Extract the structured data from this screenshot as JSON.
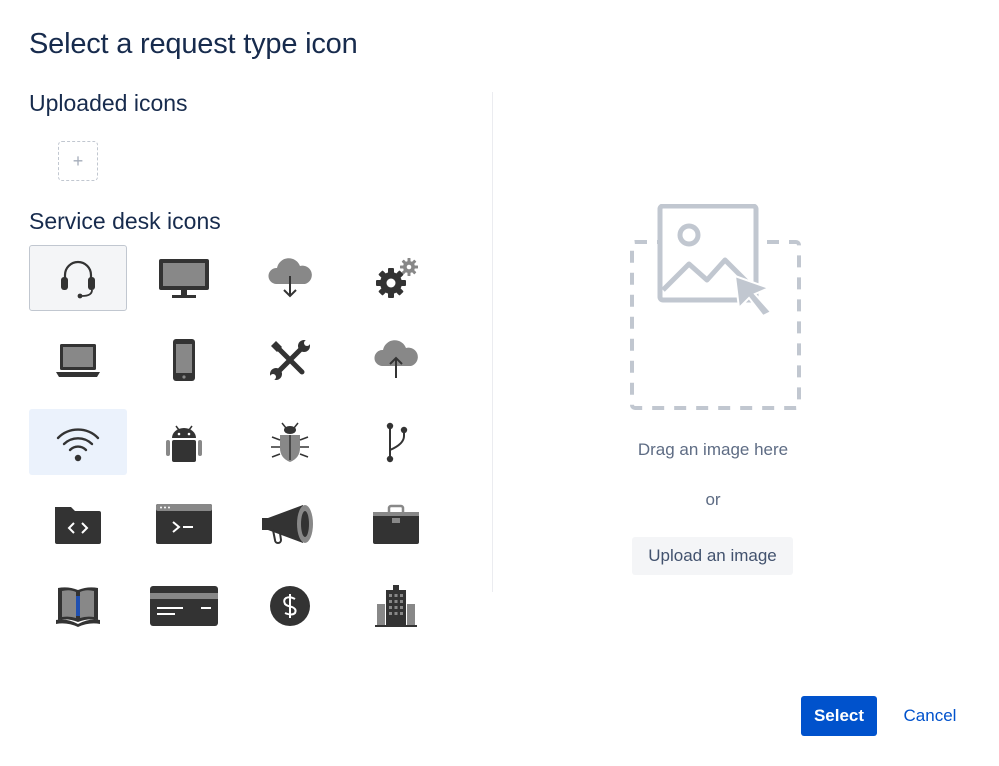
{
  "dialog": {
    "title": "Select a request type icon"
  },
  "uploaded": {
    "heading": "Uploaded icons",
    "add_label": "+"
  },
  "service": {
    "heading": "Service desk icons",
    "icons": [
      {
        "name": "headset-icon",
        "state": "selected"
      },
      {
        "name": "monitor-icon"
      },
      {
        "name": "cloud-download-icon"
      },
      {
        "name": "gears-icon"
      },
      {
        "name": "laptop-icon"
      },
      {
        "name": "smartphone-icon"
      },
      {
        "name": "tools-icon"
      },
      {
        "name": "cloud-upload-icon"
      },
      {
        "name": "wifi-icon",
        "state": "hover"
      },
      {
        "name": "android-icon"
      },
      {
        "name": "bug-icon"
      },
      {
        "name": "git-branch-icon"
      },
      {
        "name": "code-folder-icon"
      },
      {
        "name": "terminal-icon"
      },
      {
        "name": "megaphone-icon"
      },
      {
        "name": "briefcase-icon"
      },
      {
        "name": "book-icon"
      },
      {
        "name": "credit-card-icon"
      },
      {
        "name": "dollar-coin-icon"
      },
      {
        "name": "office-building-icon"
      },
      {
        "name": "partial-icon-1"
      },
      {
        "name": "partial-icon-2"
      },
      {
        "name": "partial-icon-3"
      },
      {
        "name": "partial-icon-4"
      }
    ]
  },
  "dropzone": {
    "drag_text": "Drag an image here",
    "or_text": "or",
    "upload_label": "Upload an image"
  },
  "footer": {
    "select_label": "Select",
    "cancel_label": "Cancel"
  },
  "colors": {
    "primary": "#0052cc",
    "icon_dark": "#333333",
    "icon_gray": "#8a8a8a",
    "heading": "#172b4d"
  }
}
